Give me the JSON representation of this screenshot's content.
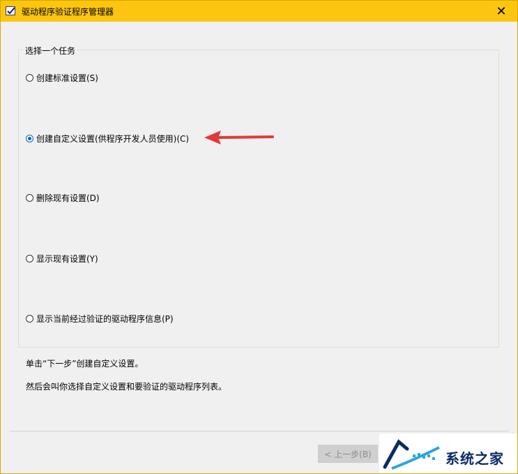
{
  "window": {
    "title": "驱动程序验证程序管理器",
    "close_glyph": "✕"
  },
  "group": {
    "label": "选择一个任务"
  },
  "options": [
    {
      "label": "创建标准设置(S)",
      "checked": false
    },
    {
      "label": "创建自定义设置(供程序开发人员使用)(C)",
      "checked": true
    },
    {
      "label": "删除现有设置(D)",
      "checked": false
    },
    {
      "label": "显示现有设置(Y)",
      "checked": false
    },
    {
      "label": "显示当前经过验证的驱动程序信息(P)",
      "checked": false
    }
  ],
  "hints": {
    "line1": "单击“下一步”创建自定义设置。",
    "line2": "然后会叫你选择自定义设置和要验证的驱动程序列表。"
  },
  "buttons": {
    "back_label": "< 上一步(B)"
  },
  "watermark": {
    "text": "系统之家"
  },
  "colors": {
    "titlebar": "#fcc50f",
    "annotation_arrow": "#e03a3a",
    "radio_selected": "#0a64c8"
  }
}
